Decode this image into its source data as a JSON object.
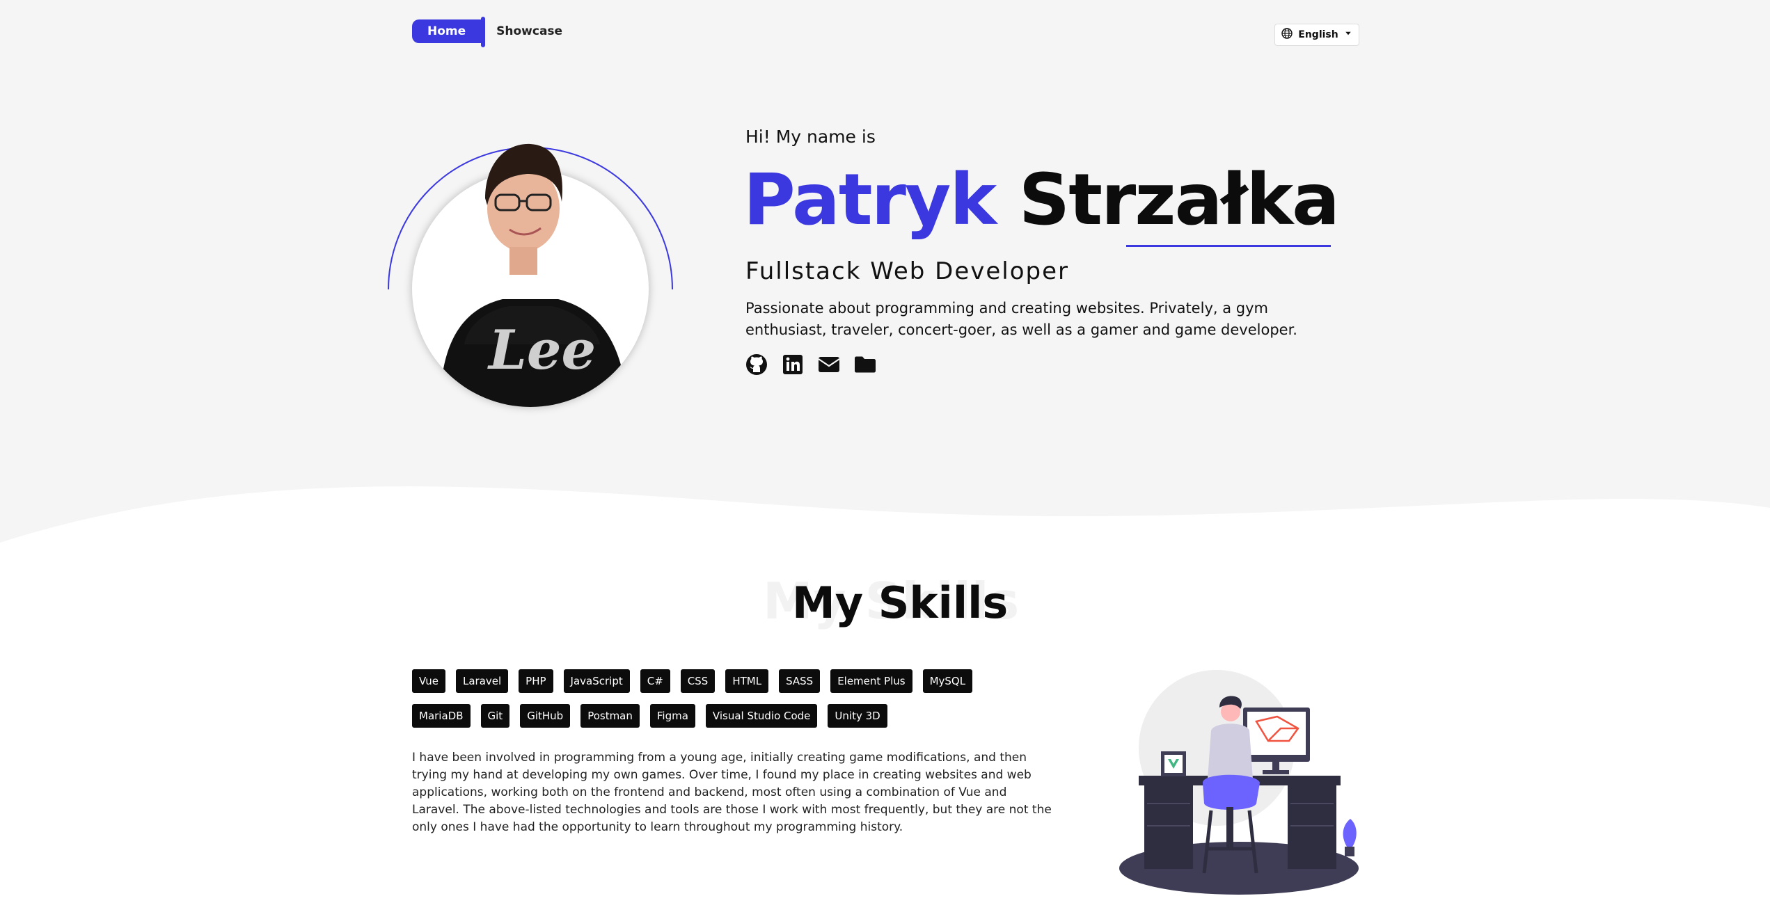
{
  "nav": {
    "home_label": "Home",
    "showcase_label": "Showcase"
  },
  "language": {
    "selected": "English"
  },
  "hero": {
    "greeting": "Hi! My name is",
    "first_name": "Patryk",
    "last_name": "Strzałka",
    "role": "Fullstack Web Developer",
    "description": "Passionate about programming and creating websites. Privately, a gym enthusiast, traveler, concert-goer, as well as a gamer and game developer.",
    "socials": [
      "github-icon",
      "linkedin-icon",
      "mail-icon",
      "folder-icon"
    ],
    "avatar_shirt_text": "Lee"
  },
  "skills": {
    "ghost_title": "My Skills",
    "title": "My Skills",
    "tags_row1": [
      "Vue",
      "Laravel",
      "PHP",
      "JavaScript",
      "C#",
      "CSS",
      "HTML",
      "SASS",
      "Element Plus",
      "MySQL"
    ],
    "tags_row2": [
      "MariaDB",
      "Git",
      "GitHub",
      "Postman",
      "Figma",
      "Visual Studio Code",
      "Unity 3D"
    ],
    "about": "I have been involved in programming from a young age, initially creating game modifications, and then trying my hand at developing my own games. Over time, I found my place in creating websites and web applications, working both on the frontend and backend, most often using a combination of Vue and Laravel. The above-listed technologies and tools are those I work with most frequently, but they are not the only ones I have had the opportunity to learn throughout my programming history."
  },
  "colors": {
    "accent": "#3b38e0",
    "background_top": "#f5f5f5",
    "dark": "#0c0c0c"
  }
}
